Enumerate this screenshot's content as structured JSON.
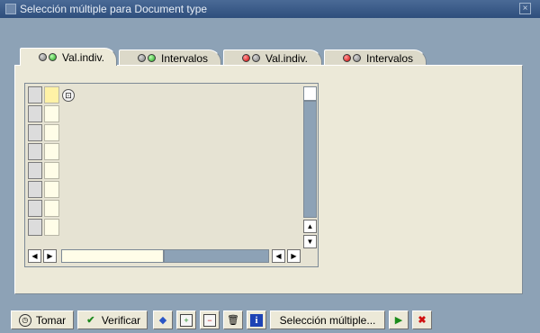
{
  "window": {
    "title": "Selección múltiple para Document type",
    "close_glyph": "×"
  },
  "tabs": [
    {
      "label": "Val.indiv.",
      "lights": [
        "gray",
        "green"
      ],
      "active": true
    },
    {
      "label": "Intervalos",
      "lights": [
        "gray",
        "green"
      ],
      "active": false
    },
    {
      "label": "Val.indiv.",
      "lights": [
        "red",
        "gray"
      ],
      "active": false
    },
    {
      "label": "Intervalos",
      "lights": [
        "red",
        "gray"
      ],
      "active": false
    }
  ],
  "grid": {
    "visible_rows": 8,
    "active_row": 0,
    "f4_help_glyph": "⊡"
  },
  "scroll": {
    "up": "▲",
    "down": "▼",
    "left": "◀",
    "right": "▶"
  },
  "footer": {
    "tomar": {
      "label": "Tomar",
      "icon": "clock-icon"
    },
    "verificar": {
      "label": "Verificar",
      "icon": "checkmark-icon"
    },
    "seleccion_multiple": {
      "label": "Selección múltiple..."
    },
    "icons": [
      "options-icon",
      "insert-row-icon",
      "delete-row-icon",
      "trash-icon",
      "info-icon",
      "import-icon",
      "cancel-icon"
    ]
  }
}
